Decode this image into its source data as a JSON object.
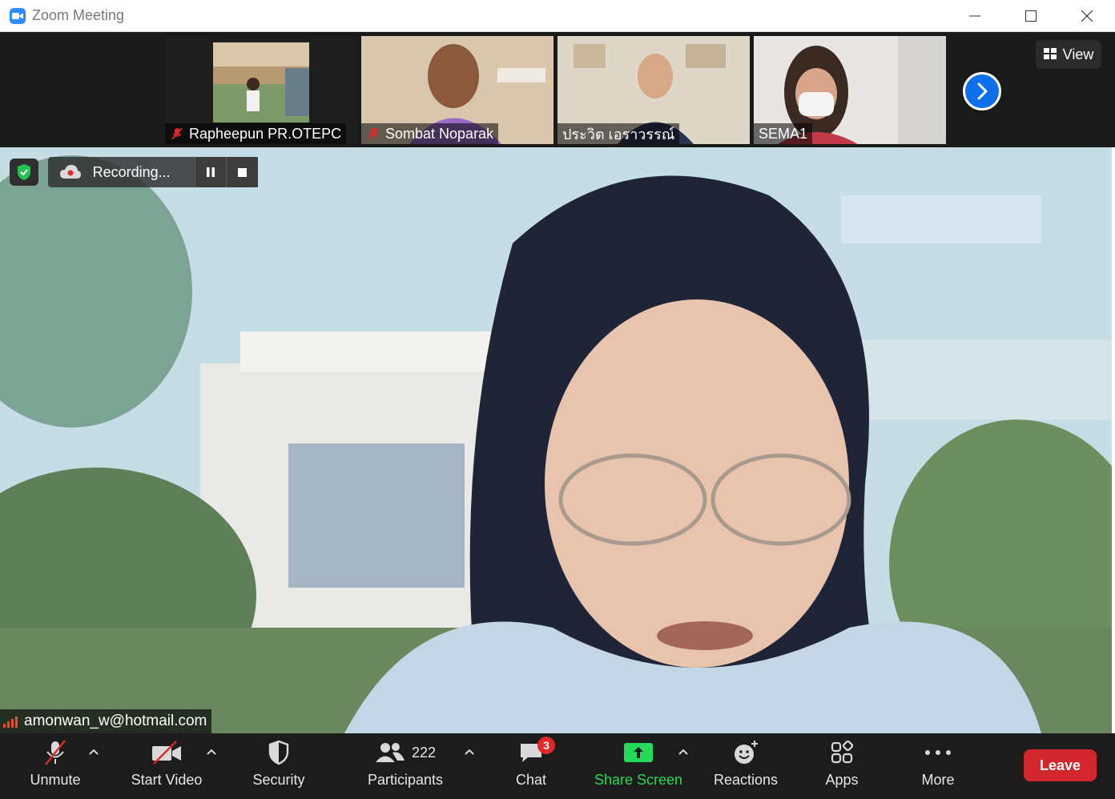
{
  "window": {
    "title": "Zoom Meeting",
    "minimize_icon": "minimize-icon",
    "maximize_icon": "maximize-icon",
    "close_icon": "close-icon"
  },
  "participants_strip": [
    {
      "name": "Rapheepun PR.OTEPC",
      "muted": true
    },
    {
      "name": "Sombat Noparak",
      "muted": true
    },
    {
      "name": "ประวิต  เอราวรรณ์",
      "muted": false
    },
    {
      "name": "SEMA1",
      "muted": false
    }
  ],
  "view_button": {
    "label": "View",
    "icon": "grid-icon"
  },
  "next_page_icon": "chevron-right-icon",
  "recording": {
    "label": "Recording...",
    "pause_icon": "pause-icon",
    "stop_icon": "stop-icon"
  },
  "security_badge_icon": "shield-check-icon",
  "active_speaker": {
    "name": "amonwan_w@hotmail.com"
  },
  "toolbar": {
    "unmute": "Unmute",
    "start_video": "Start Video",
    "security": "Security",
    "participants": "Participants",
    "participants_count": "222",
    "chat": "Chat",
    "chat_badge": "3",
    "share_screen": "Share Screen",
    "reactions": "Reactions",
    "apps": "Apps",
    "more": "More",
    "leave": "Leave"
  },
  "colors": {
    "accent_blue": "#0e71eb",
    "share_green": "#23d959",
    "leave_red": "#d1272c",
    "muted_red": "#e02828"
  }
}
